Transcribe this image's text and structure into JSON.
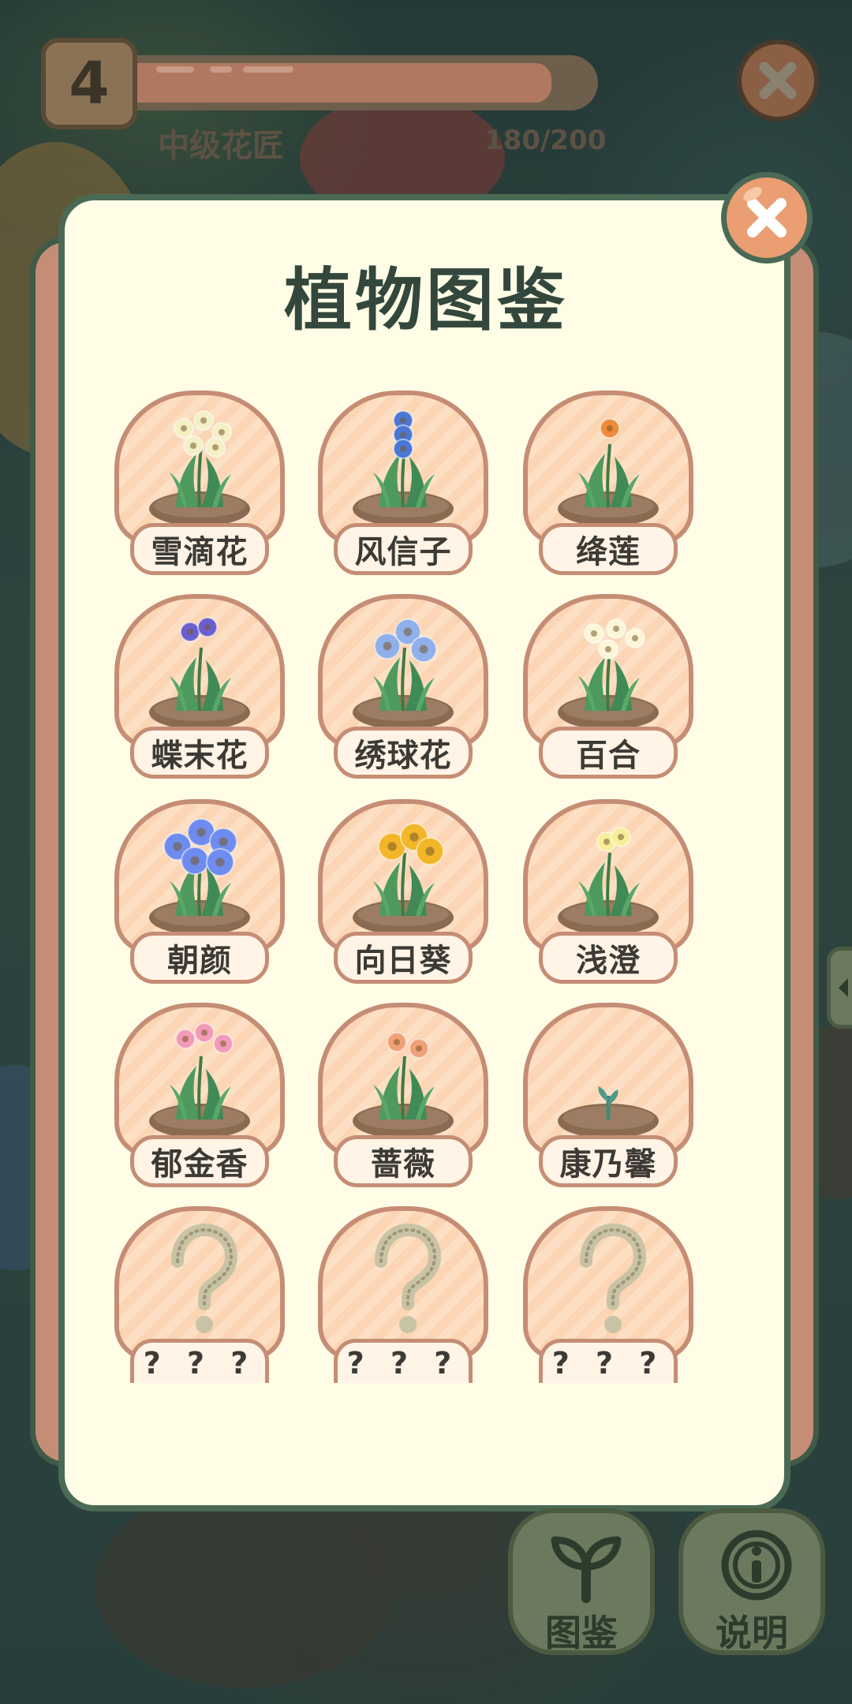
{
  "hud": {
    "level": "4",
    "rank_title": "中级花匠",
    "xp_text": "180/200",
    "xp_progress": 0.9
  },
  "dialog": {
    "title": "植物图鉴"
  },
  "plants": [
    {
      "name": "雪滴花",
      "unlocked": true,
      "flower_color": "#f3f0c6"
    },
    {
      "name": "风信子",
      "unlocked": true,
      "flower_color": "#4a76d6"
    },
    {
      "name": "绛莲",
      "unlocked": true,
      "flower_color": "#f08a3a"
    },
    {
      "name": "蝶末花",
      "unlocked": true,
      "flower_color": "#6a5ed0"
    },
    {
      "name": "绣球花",
      "unlocked": true,
      "flower_color": "#8fb0ea"
    },
    {
      "name": "百合",
      "unlocked": true,
      "flower_color": "#fbf6d8"
    },
    {
      "name": "朝颜",
      "unlocked": true,
      "flower_color": "#6e8cf0"
    },
    {
      "name": "向日葵",
      "unlocked": true,
      "flower_color": "#f2b628"
    },
    {
      "name": "浅澄",
      "unlocked": true,
      "flower_color": "#f6ee9a"
    },
    {
      "name": "郁金香",
      "unlocked": true,
      "flower_color": "#f39ab8"
    },
    {
      "name": "蔷薇",
      "unlocked": true,
      "flower_color": "#f0a078"
    },
    {
      "name": "康乃馨",
      "unlocked": true,
      "flower_color": "#3f8a78"
    },
    {
      "name": "? ? ?",
      "unlocked": false
    },
    {
      "name": "? ? ?",
      "unlocked": false
    },
    {
      "name": "? ? ?",
      "unlocked": false
    }
  ],
  "bottom": {
    "collection_label": "图鉴",
    "info_label": "说明"
  },
  "colors": {
    "panel_bg": "#fffde6",
    "panel_border": "#4a6a55",
    "card_border": "#c58d75",
    "title_text": "#33473d"
  }
}
